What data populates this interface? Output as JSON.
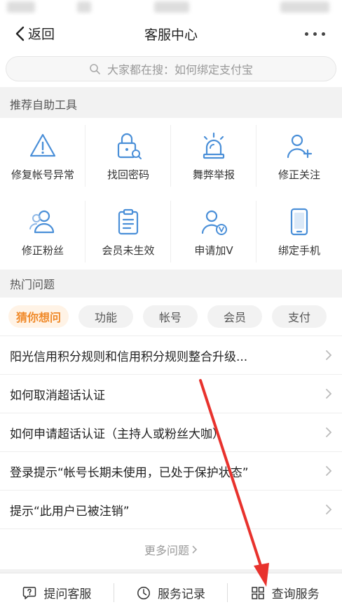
{
  "header": {
    "back_label": "返回",
    "title": "客服中心",
    "more_icon": "more-dots-icon"
  },
  "search": {
    "placeholder": "大家都在搜：如何绑定支付宝",
    "icon": "search-icon"
  },
  "tools_section": {
    "title": "推荐自助工具",
    "items": [
      {
        "label": "修复帐号异常",
        "icon": "warning-icon"
      },
      {
        "label": "找回密码",
        "icon": "lock-search-icon"
      },
      {
        "label": "舞弊举报",
        "icon": "alarm-light-icon"
      },
      {
        "label": "修正关注",
        "icon": "user-add-icon"
      },
      {
        "label": "修正粉丝",
        "icon": "users-icon"
      },
      {
        "label": "会员未生效",
        "icon": "clipboard-icon"
      },
      {
        "label": "申请加V",
        "icon": "user-verified-icon"
      },
      {
        "label": "绑定手机",
        "icon": "phone-icon"
      }
    ]
  },
  "hot_section": {
    "title": "热门问题",
    "chips": [
      "猜你想问",
      "功能",
      "帐号",
      "会员",
      "支付"
    ],
    "active_chip": "猜你想问",
    "questions": [
      "阳光信用积分规则和信用积分规则整合升级...",
      "如何取消超话认证",
      "如何申请超话认证（主持人或粉丝大咖）",
      "登录提示“帐号长期未使用，已处于保护状态”",
      "提示“此用户已被注销”"
    ],
    "more_label": "更多问题"
  },
  "bottom_bar": {
    "items": [
      {
        "label": "提问客服",
        "icon": "question-bubble-icon"
      },
      {
        "label": "服务记录",
        "icon": "clock-icon"
      },
      {
        "label": "查询服务",
        "icon": "grid-icon"
      }
    ]
  },
  "colors": {
    "accent": "#f08a2a",
    "icon_blue": "#4a8fd8",
    "annotation_red": "#e8322d"
  }
}
